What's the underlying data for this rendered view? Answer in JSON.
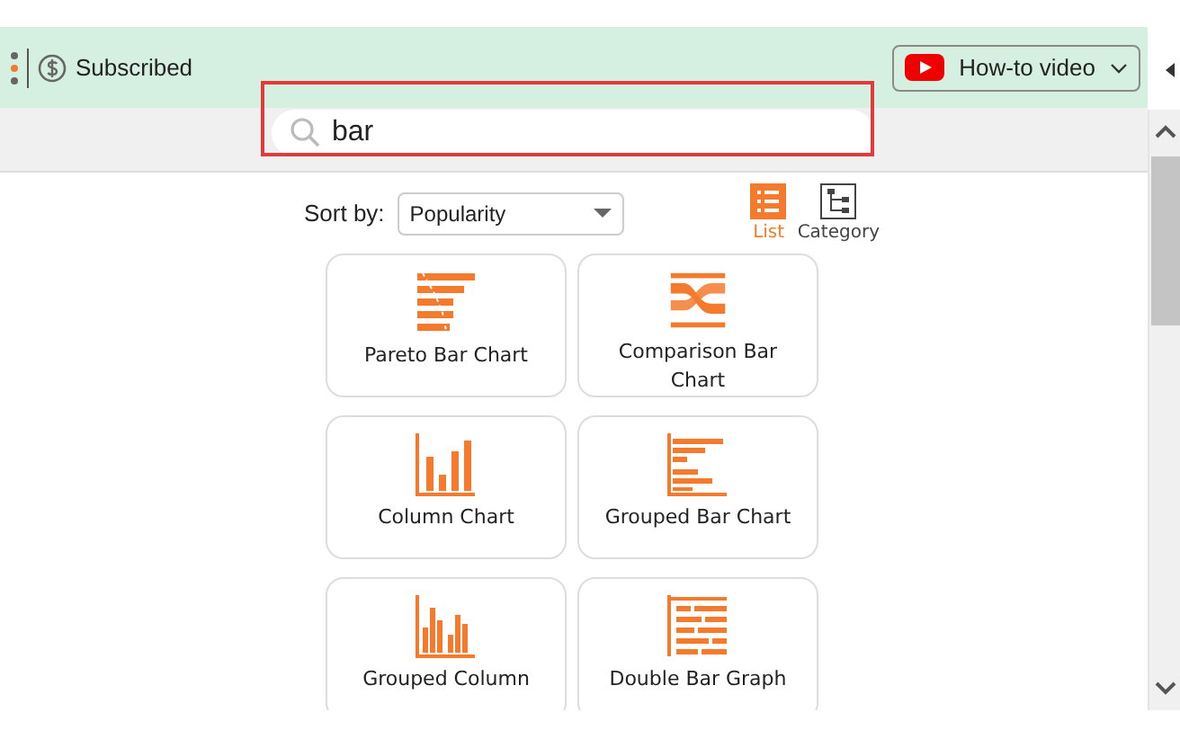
{
  "header": {
    "status": "Subscribed",
    "video_button": "How-to video"
  },
  "search": {
    "value": "bar",
    "highlighted": true
  },
  "sort": {
    "label": "Sort by:",
    "value": "Popularity"
  },
  "views": [
    {
      "label": "List",
      "kind": "list",
      "selected": true
    },
    {
      "label": "Category",
      "kind": "category",
      "selected": false
    }
  ],
  "charts": [
    {
      "label": "Pareto Bar Chart",
      "kind": "pareto"
    },
    {
      "label": "Comparison Bar Chart",
      "kind": "comparison"
    },
    {
      "label": "Column Chart",
      "kind": "column"
    },
    {
      "label": "Grouped Bar Chart",
      "kind": "grouped-bar"
    },
    {
      "label": "Grouped Column",
      "kind": "grouped-column"
    },
    {
      "label": "Double Bar Graph",
      "kind": "double-bar"
    }
  ]
}
